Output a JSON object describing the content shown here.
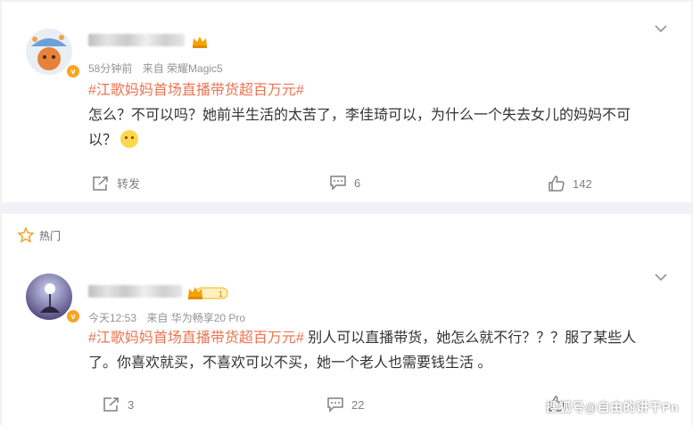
{
  "posts": [
    {
      "time": "58分钟前",
      "source": "来自 荣耀Magic5",
      "tag": "#江歌妈妈首场直播带货超百万元#",
      "text_line1": "怎么？不可以吗？她前半生活的太苦了，李佳琦可以，为什么一个失去女儿的妈妈不可",
      "text_line2": "以？",
      "actions": {
        "repost": "转发",
        "comments": "6",
        "likes": "142"
      }
    },
    {
      "section_label": "热门",
      "time": "今天12:53",
      "source": "来自 华为畅享20 Pro",
      "tag": "#江歌妈妈首场直播带货超百万元#",
      "text_line1": " 别人可以直播带货，她怎么就不行？？？服了某些人",
      "text_line2": "了。你喜欢就买，不喜欢可以不买，她一个老人也需要钱生活 。",
      "actions": {
        "repost": "3",
        "comments": "22"
      }
    }
  ],
  "watermark": "搜狐号@自由的讲干Pn",
  "colors": {
    "tag": "#eb7350",
    "background": "#f1f2f5",
    "badge": "#f6a623"
  }
}
